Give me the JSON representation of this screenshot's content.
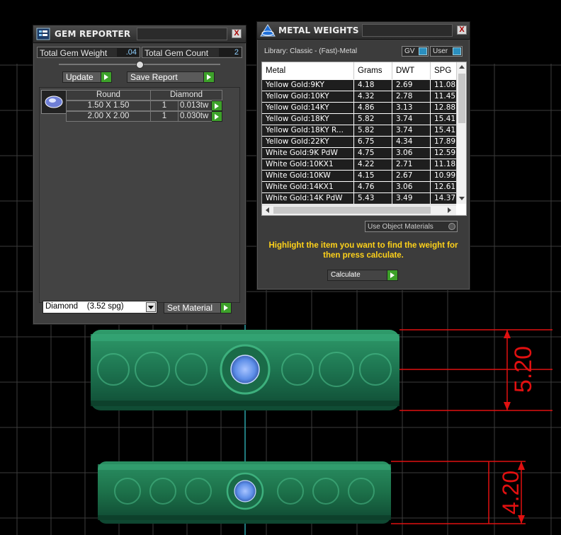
{
  "gem_reporter": {
    "title": "GEM REPORTER",
    "close_glyph": "X",
    "total_weight_label": "Total Gem Weight",
    "total_weight_value": ".04",
    "total_count_label": "Total Gem Count",
    "total_count_value": "2",
    "update_label": "Update",
    "save_report_label": "Save Report",
    "table_headers": {
      "shape": "Round",
      "stone": "Diamond"
    },
    "rows": [
      {
        "size": "1.50 X 1.50",
        "count": "1",
        "weight": "0.013tw"
      },
      {
        "size": "2.00 X 2.00",
        "count": "1",
        "weight": "0.030tw"
      }
    ],
    "material_select": "Diamond    (3.52 spg)",
    "set_material_label": "Set Material"
  },
  "metal_weights": {
    "title": "METAL WEIGHTS",
    "close_glyph": "X",
    "library_label": "Library: Classic - (Fast)-Metal",
    "gv_label": "GV",
    "user_label": "User",
    "columns": [
      "Metal",
      "Grams",
      "DWT",
      "SPG"
    ],
    "rows": [
      {
        "metal": "Yellow Gold:9KY",
        "grams": "4.18",
        "dwt": "2.69",
        "spg": "11.08"
      },
      {
        "metal": "Yellow Gold:10KY",
        "grams": "4.32",
        "dwt": "2.78",
        "spg": "11.45"
      },
      {
        "metal": "Yellow Gold:14KY",
        "grams": "4.86",
        "dwt": "3.13",
        "spg": "12.88"
      },
      {
        "metal": "Yellow Gold:18KY",
        "grams": "5.82",
        "dwt": "3.74",
        "spg": "15.41"
      },
      {
        "metal": "Yellow Gold:18KY R...",
        "grams": "5.82",
        "dwt": "3.74",
        "spg": "15.41"
      },
      {
        "metal": "Yellow Gold:22KY",
        "grams": "6.75",
        "dwt": "4.34",
        "spg": "17.89"
      },
      {
        "metal": "White Gold:9K PdW",
        "grams": "4.75",
        "dwt": "3.06",
        "spg": "12.59"
      },
      {
        "metal": "White Gold:10KX1",
        "grams": "4.22",
        "dwt": "2.71",
        "spg": "11.18"
      },
      {
        "metal": "White Gold:10KW",
        "grams": "4.15",
        "dwt": "2.67",
        "spg": "10.99"
      },
      {
        "metal": "White Gold:14KX1",
        "grams": "4.76",
        "dwt": "3.06",
        "spg": "12.61"
      },
      {
        "metal": "White Gold:14K PdW",
        "grams": "5.43",
        "dwt": "3.49",
        "spg": "14.37"
      }
    ],
    "use_object_materials_label": "Use Object Materials",
    "hint_text": "Highlight the item you want to find the weight for then press calculate.",
    "calculate_label": "Calculate"
  },
  "viewport": {
    "dimension_top": "5.20",
    "dimension_bottom": "4.20",
    "ring_color": "#1f7a55",
    "gem_color": "#5d8ee8",
    "dimension_color": "#e01010"
  }
}
